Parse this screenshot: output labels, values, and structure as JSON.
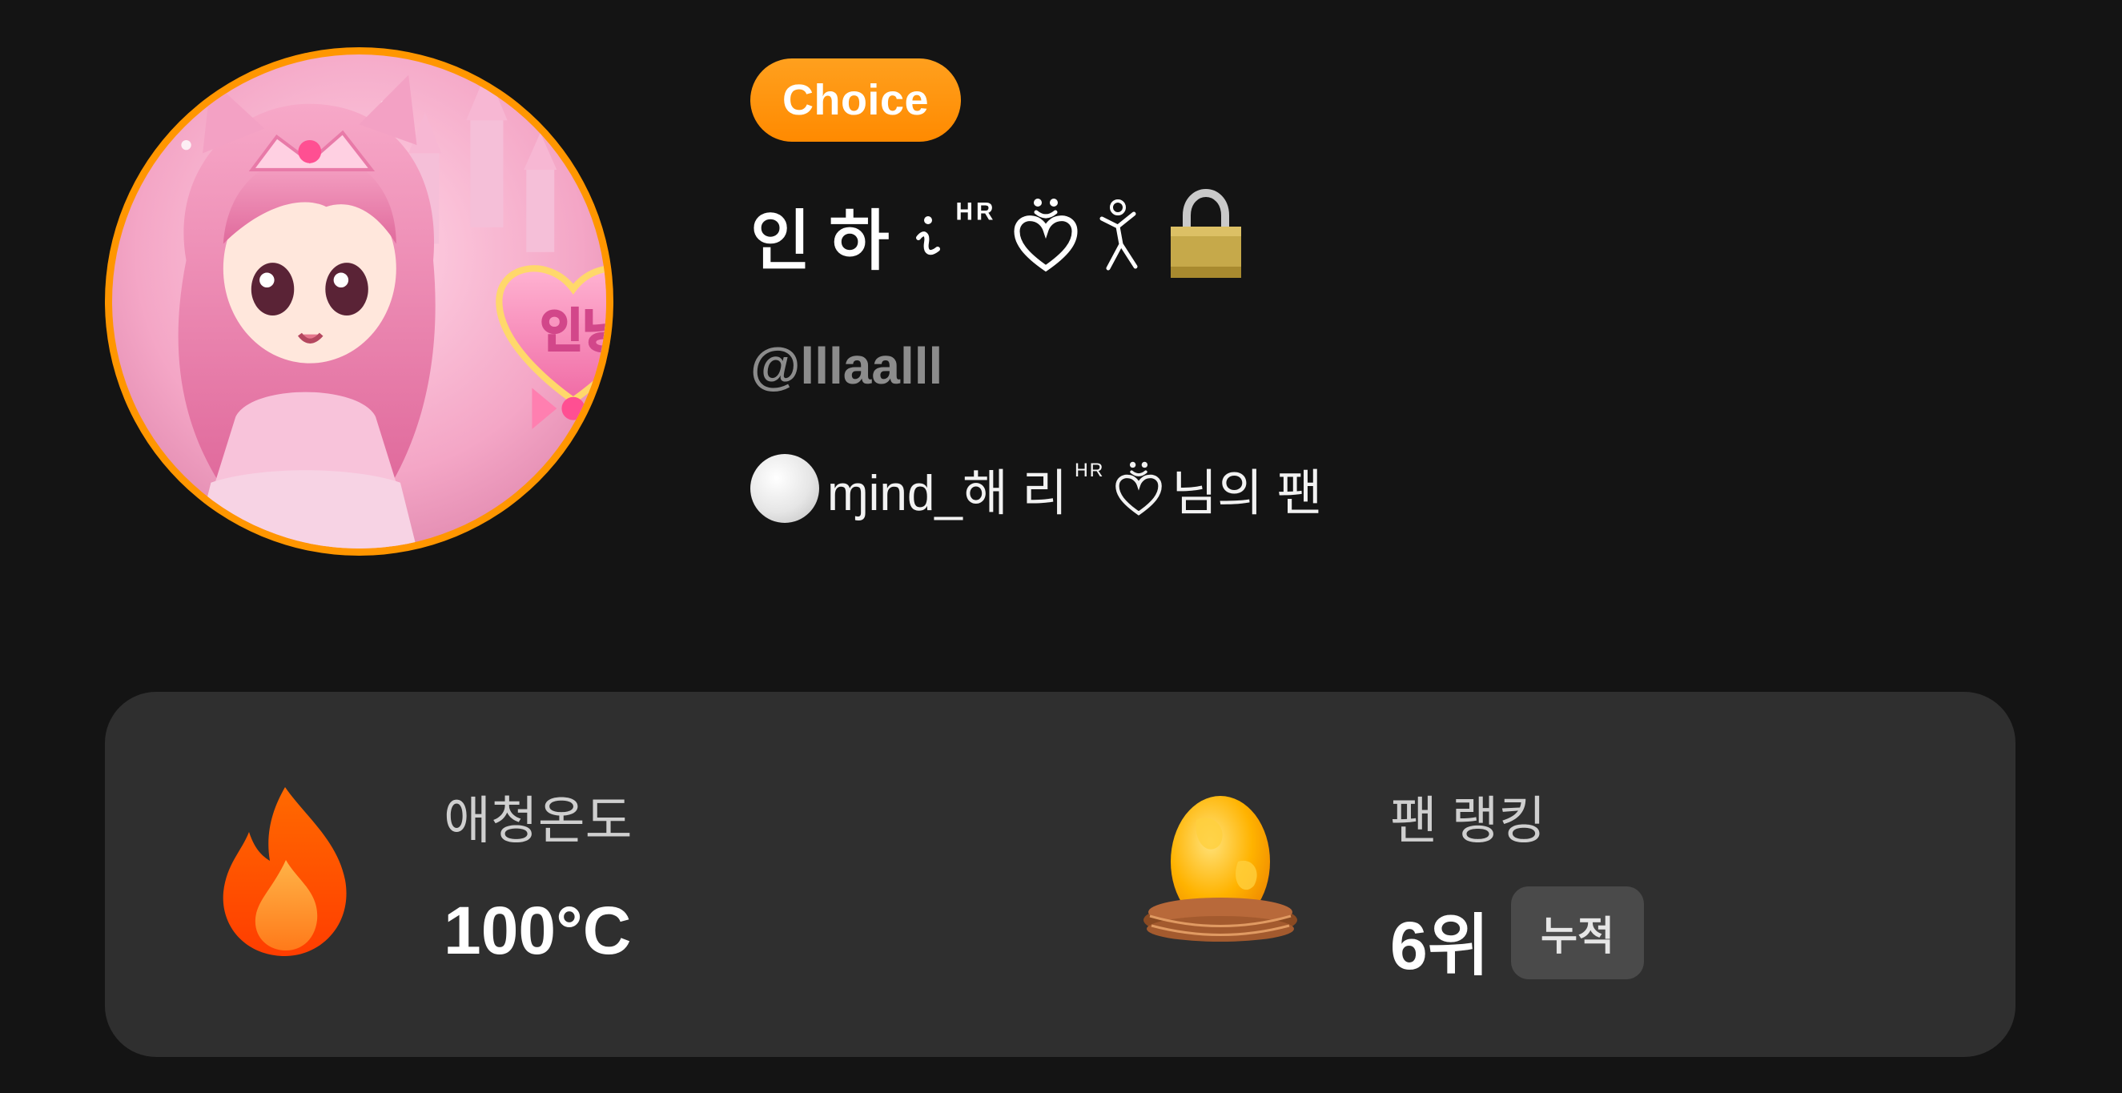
{
  "profile": {
    "badge": "Choice",
    "name": "인 하",
    "name_suffix": "ᴴᴿ",
    "handle": "@lllaalll",
    "fan_prefix": "ɱind_해 리",
    "fan_sup": "ᴴᴿ",
    "fan_suffix": "님의 팬",
    "avatar_caption": "인냥핑",
    "icons": [
      "heart-face-icon",
      "dancer-icon",
      "padlock-icon",
      "white-circle-icon"
    ]
  },
  "stats": {
    "temperature": {
      "icon": "fire-icon",
      "label": "애청온도",
      "value": "100°C"
    },
    "ranking": {
      "icon": "egg-nest-icon",
      "label": "팬 랭킹",
      "value": "6위",
      "badge": "누적"
    }
  },
  "colors": {
    "background": "#141414",
    "card": "#2f2f2f",
    "accent": "#ff9600",
    "muted": "#8c8c8c"
  }
}
